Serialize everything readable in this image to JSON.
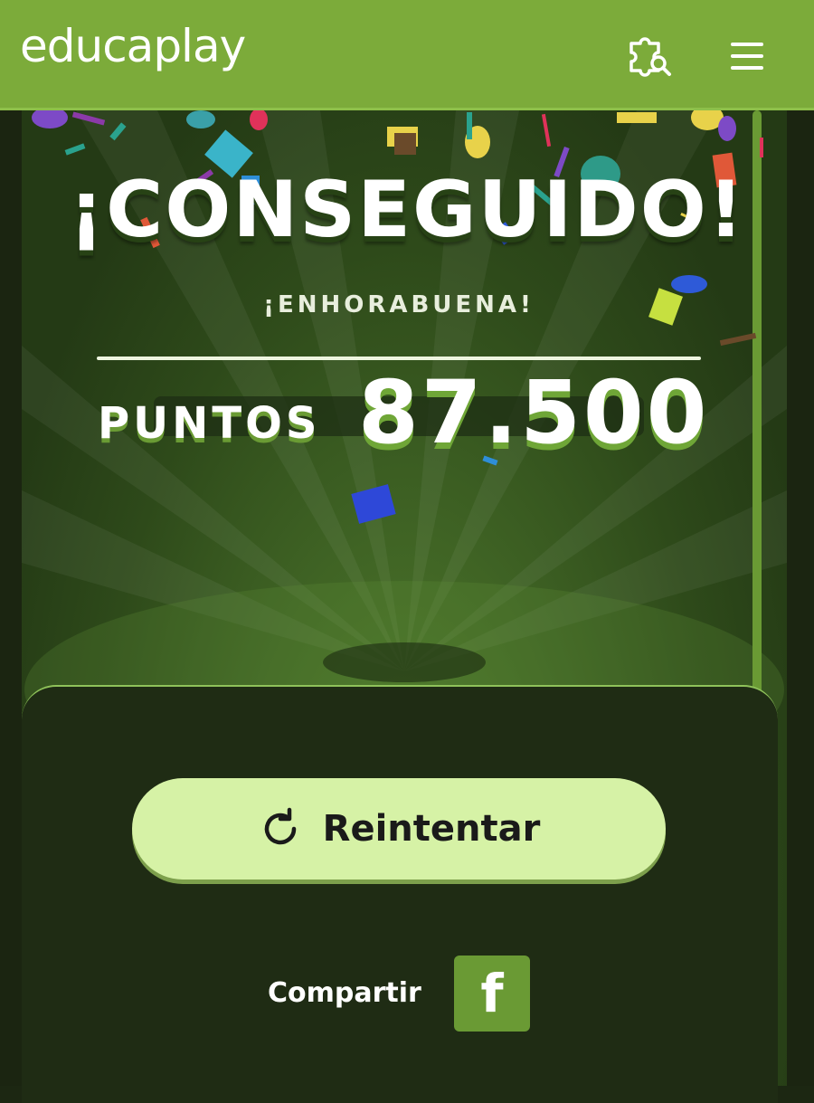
{
  "header": {
    "logo_text": "educaplay",
    "icons": [
      "puzzle-search-icon",
      "hamburger-menu-icon"
    ],
    "bg_color": "#7cab3a"
  },
  "result": {
    "headline": "¡CONSEGUIDO!",
    "subtitle": "¡ENHORABUENA!",
    "points_label": "PUNTOS",
    "points_value": "87.500"
  },
  "actions": {
    "retry_label": "Reintentar",
    "retry_icon": "refresh-icon",
    "share_label": "Compartir",
    "share_icon": "facebook-icon",
    "facebook_glyph": "f"
  },
  "colors": {
    "accent": "#7cab3a",
    "button_bg": "#d6f2a6",
    "panel_bg": "#1f2c14"
  }
}
